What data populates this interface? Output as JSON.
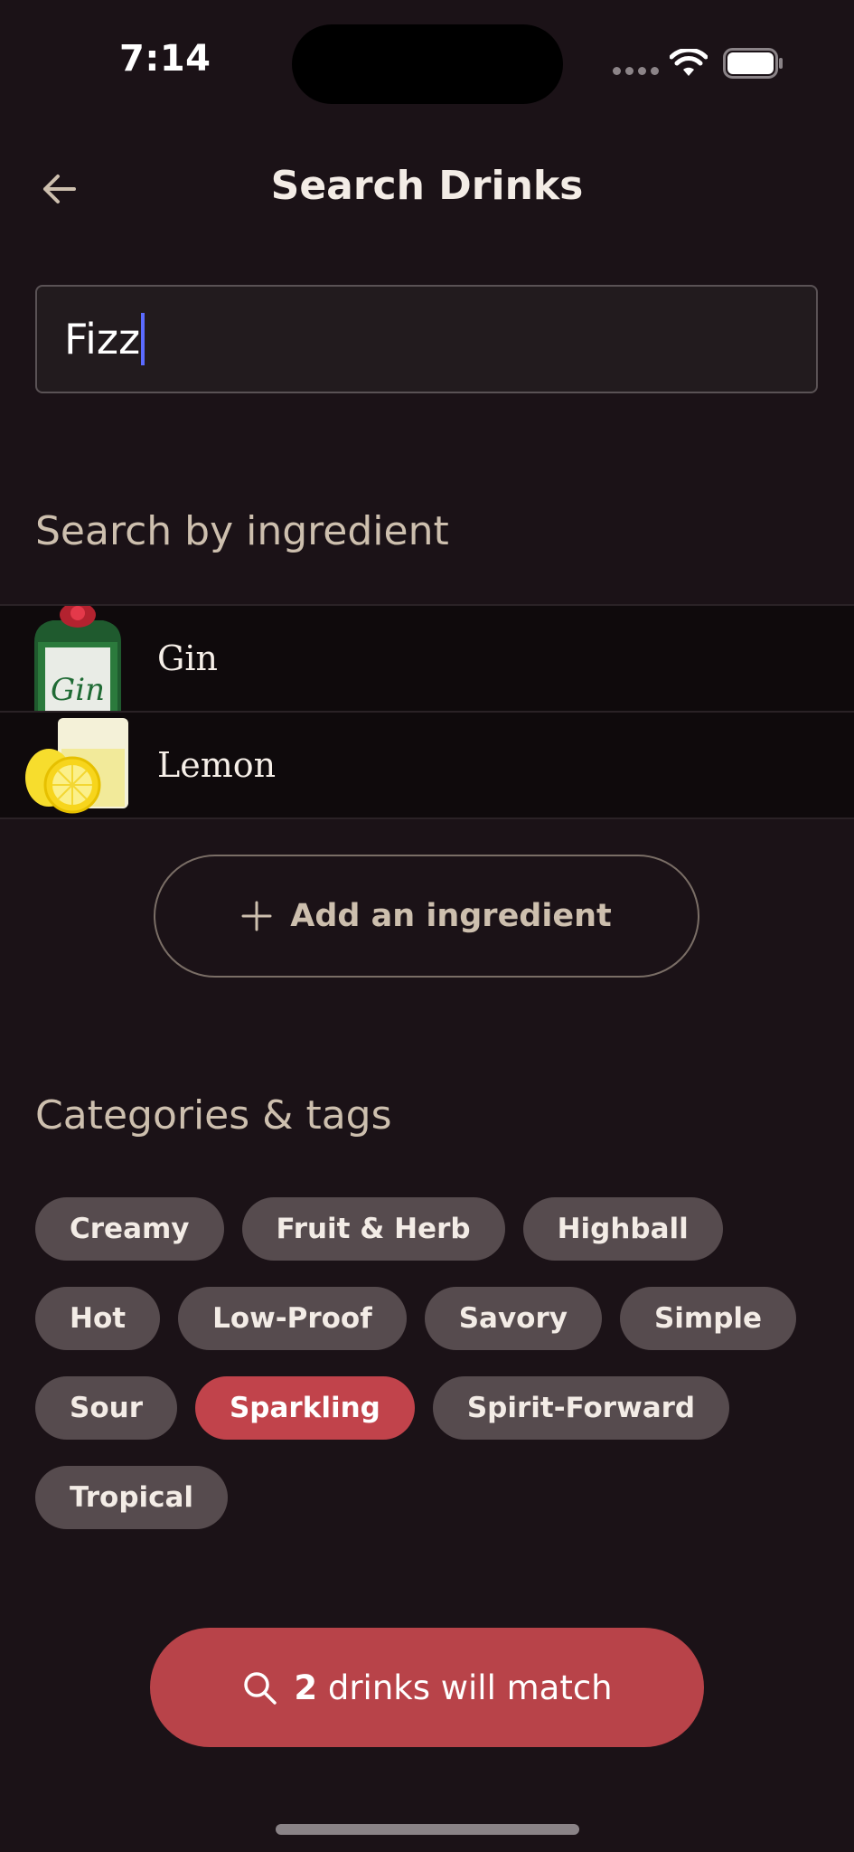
{
  "status_bar": {
    "time": "7:14"
  },
  "header": {
    "title": "Search Drinks",
    "back_icon": "arrow-left-icon"
  },
  "search": {
    "value": "Fizz"
  },
  "ingredients_section": {
    "title": "Search by ingredient",
    "items": [
      {
        "name": "Gin",
        "icon": "gin-bottle-icon"
      },
      {
        "name": "Lemon",
        "icon": "lemon-icon"
      }
    ],
    "add_label": "Add an ingredient"
  },
  "tags_section": {
    "title": "Categories & tags",
    "tags": [
      {
        "label": "Creamy",
        "selected": false
      },
      {
        "label": "Fruit & Herb",
        "selected": false
      },
      {
        "label": "Highball",
        "selected": false
      },
      {
        "label": "Hot",
        "selected": false
      },
      {
        "label": "Low-Proof",
        "selected": false
      },
      {
        "label": "Savory",
        "selected": false
      },
      {
        "label": "Simple",
        "selected": false
      },
      {
        "label": "Sour",
        "selected": false
      },
      {
        "label": "Sparkling",
        "selected": true
      },
      {
        "label": "Spirit-Forward",
        "selected": false
      },
      {
        "label": "Tropical",
        "selected": false
      }
    ]
  },
  "match_button": {
    "count": "2",
    "label": "drinks will match"
  },
  "colors": {
    "background": "#1b1217",
    "accent": "#c1434b",
    "chip": "#564b4e",
    "muted_text": "#cdbfae"
  }
}
